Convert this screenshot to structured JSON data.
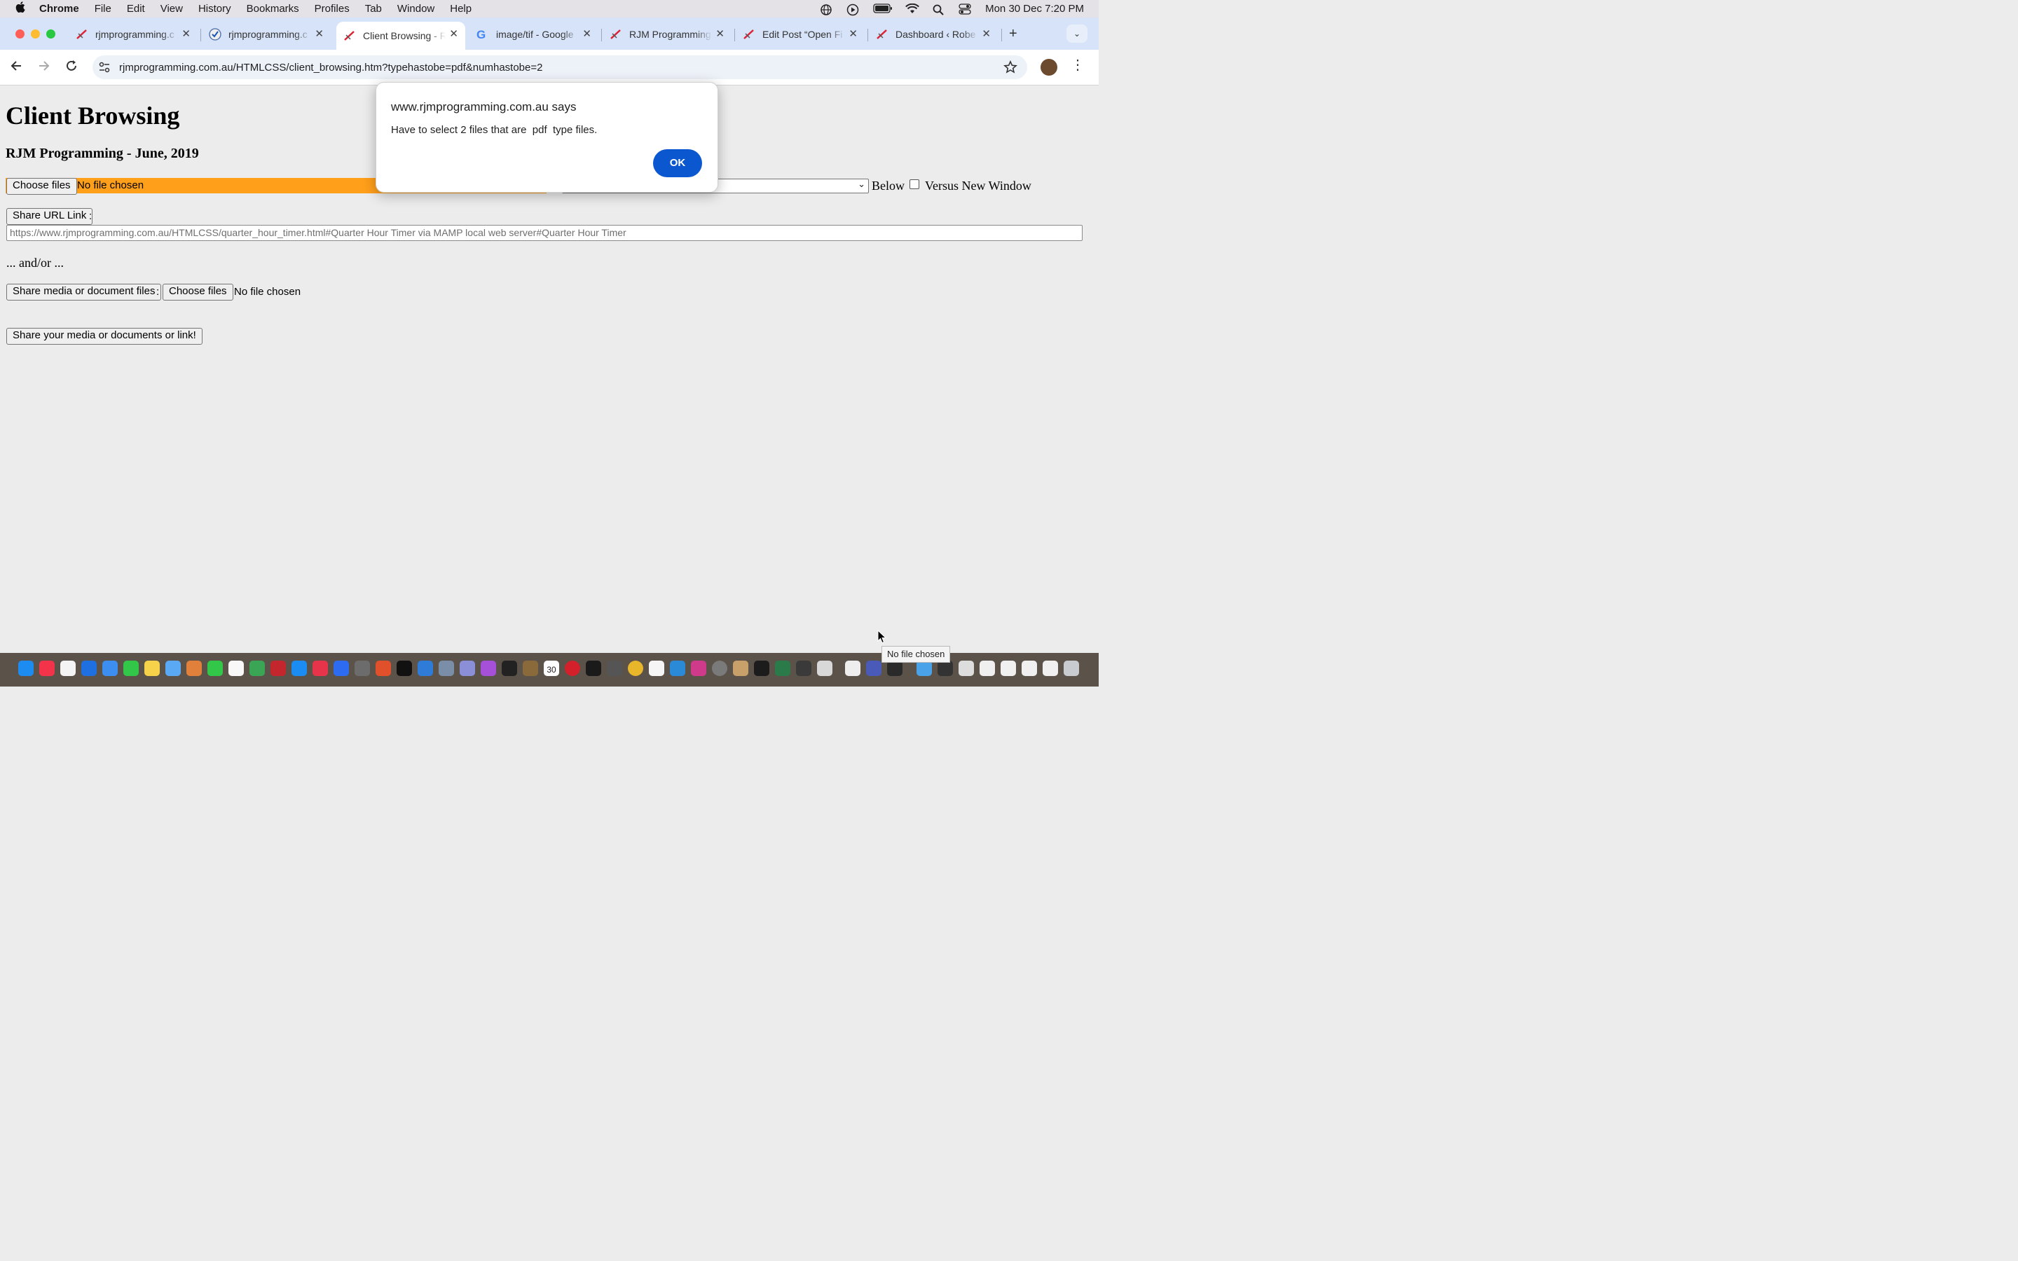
{
  "menubar": {
    "app": "Chrome",
    "items": [
      "File",
      "Edit",
      "View",
      "History",
      "Bookmarks",
      "Profiles",
      "Tab",
      "Window",
      "Help"
    ],
    "clock": "Mon 30 Dec  7:20 PM"
  },
  "tabs": [
    {
      "title": "rjmprogramming.c"
    },
    {
      "title": "rjmprogramming.c"
    },
    {
      "title": "Client Browsing - R"
    },
    {
      "title": "image/tif - Google"
    },
    {
      "title": "RJM Programming"
    },
    {
      "title": "Edit Post “Open Fi"
    },
    {
      "title": "Dashboard ‹ Robe"
    }
  ],
  "address": {
    "url": "rjmprogramming.com.au/HTMLCSS/client_browsing.htm?typehastobe=pdf&numhastobe=2"
  },
  "page": {
    "title": "Client Browsing",
    "subtitle": "RJM Programming - June, 2019",
    "choose_files_label": "Choose files",
    "no_file_chosen": "No file chosen",
    "below_label": "Below",
    "versus_new_window_label": "Versus New Window",
    "share_url_label": "Share URL Link",
    "colon": ":",
    "url_value": "https://www.rjmprogramming.com.au/HTMLCSS/quarter_hour_timer.html#Quarter Hour Timer via MAMP local web server#Quarter Hour Timer",
    "and_or": "... and/or ...",
    "share_media_label": "Share media or document files",
    "choose_files_label2": "Choose files",
    "no_file_chosen2": "No file chosen",
    "share_submit_label": "Share your media or documents or link!"
  },
  "dialog": {
    "origin": "www.rjmprogramming.com.au says",
    "message": "Have to select 2 files that are  pdf  type files.",
    "ok_label": "OK"
  },
  "dock": {
    "calendar_day": "30",
    "tooltip": "No file chosen"
  },
  "colors": {
    "accent": "#0b57d0",
    "file_highlight": "#ff9f1a",
    "tabstrip": "#d6e3f8"
  }
}
